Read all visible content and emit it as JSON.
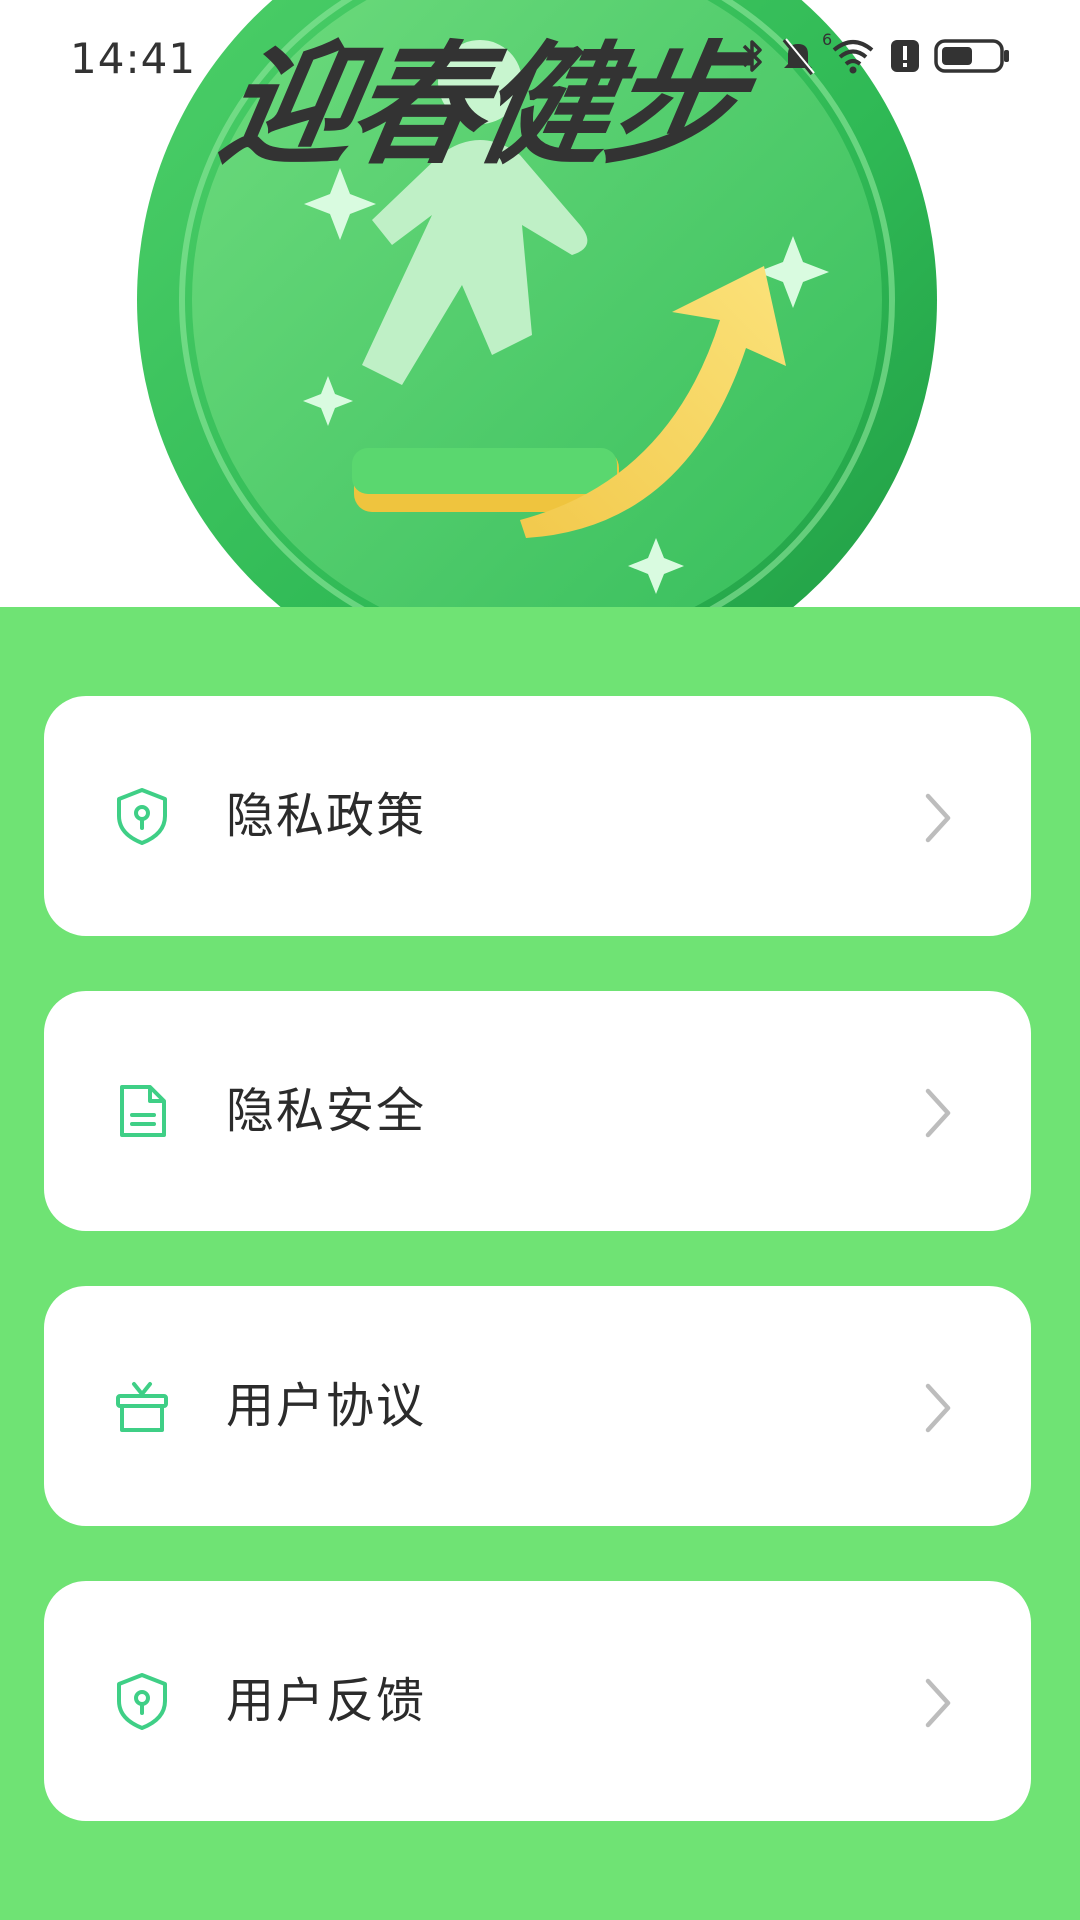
{
  "status_bar": {
    "time": "14:41",
    "icons": [
      "bluetooth-icon",
      "mute-icon",
      "wifi-icon",
      "alert-icon",
      "battery-icon"
    ],
    "wifi_label": "6",
    "battery_level": 0.55
  },
  "hero": {
    "title": "迎春健步",
    "emblem": "walking-person-arrow-emblem"
  },
  "colors": {
    "background": "#6fe374",
    "card": "#ffffff",
    "icon_accent": "#3fcf86",
    "chevron": "#bdbdbd",
    "text": "#2b2b2b"
  },
  "menu": {
    "items": [
      {
        "label": "隐私政策",
        "icon": "shield-icon"
      },
      {
        "label": "隐私安全",
        "icon": "document-icon"
      },
      {
        "label": "用户协议",
        "icon": "gift-box-icon"
      },
      {
        "label": "用户反馈",
        "icon": "shield-icon"
      }
    ]
  }
}
